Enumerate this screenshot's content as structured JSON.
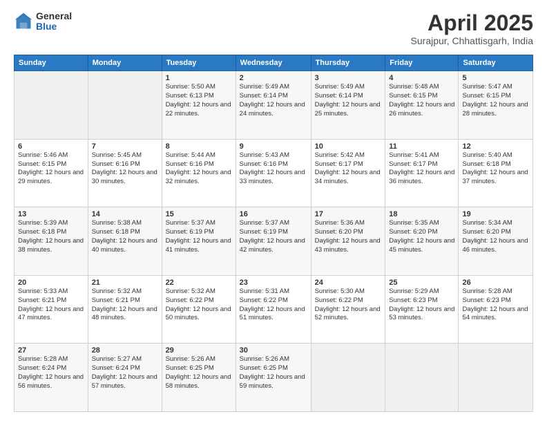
{
  "header": {
    "logo_general": "General",
    "logo_blue": "Blue",
    "title": "April 2025",
    "location": "Surajpur, Chhattisgarh, India"
  },
  "weekdays": [
    "Sunday",
    "Monday",
    "Tuesday",
    "Wednesday",
    "Thursday",
    "Friday",
    "Saturday"
  ],
  "weeks": [
    [
      {
        "day": "",
        "info": ""
      },
      {
        "day": "",
        "info": ""
      },
      {
        "day": "1",
        "info": "Sunrise: 5:50 AM\nSunset: 6:13 PM\nDaylight: 12 hours and 22 minutes."
      },
      {
        "day": "2",
        "info": "Sunrise: 5:49 AM\nSunset: 6:14 PM\nDaylight: 12 hours and 24 minutes."
      },
      {
        "day": "3",
        "info": "Sunrise: 5:49 AM\nSunset: 6:14 PM\nDaylight: 12 hours and 25 minutes."
      },
      {
        "day": "4",
        "info": "Sunrise: 5:48 AM\nSunset: 6:15 PM\nDaylight: 12 hours and 26 minutes."
      },
      {
        "day": "5",
        "info": "Sunrise: 5:47 AM\nSunset: 6:15 PM\nDaylight: 12 hours and 28 minutes."
      }
    ],
    [
      {
        "day": "6",
        "info": "Sunrise: 5:46 AM\nSunset: 6:15 PM\nDaylight: 12 hours and 29 minutes."
      },
      {
        "day": "7",
        "info": "Sunrise: 5:45 AM\nSunset: 6:16 PM\nDaylight: 12 hours and 30 minutes."
      },
      {
        "day": "8",
        "info": "Sunrise: 5:44 AM\nSunset: 6:16 PM\nDaylight: 12 hours and 32 minutes."
      },
      {
        "day": "9",
        "info": "Sunrise: 5:43 AM\nSunset: 6:16 PM\nDaylight: 12 hours and 33 minutes."
      },
      {
        "day": "10",
        "info": "Sunrise: 5:42 AM\nSunset: 6:17 PM\nDaylight: 12 hours and 34 minutes."
      },
      {
        "day": "11",
        "info": "Sunrise: 5:41 AM\nSunset: 6:17 PM\nDaylight: 12 hours and 36 minutes."
      },
      {
        "day": "12",
        "info": "Sunrise: 5:40 AM\nSunset: 6:18 PM\nDaylight: 12 hours and 37 minutes."
      }
    ],
    [
      {
        "day": "13",
        "info": "Sunrise: 5:39 AM\nSunset: 6:18 PM\nDaylight: 12 hours and 38 minutes."
      },
      {
        "day": "14",
        "info": "Sunrise: 5:38 AM\nSunset: 6:18 PM\nDaylight: 12 hours and 40 minutes."
      },
      {
        "day": "15",
        "info": "Sunrise: 5:37 AM\nSunset: 6:19 PM\nDaylight: 12 hours and 41 minutes."
      },
      {
        "day": "16",
        "info": "Sunrise: 5:37 AM\nSunset: 6:19 PM\nDaylight: 12 hours and 42 minutes."
      },
      {
        "day": "17",
        "info": "Sunrise: 5:36 AM\nSunset: 6:20 PM\nDaylight: 12 hours and 43 minutes."
      },
      {
        "day": "18",
        "info": "Sunrise: 5:35 AM\nSunset: 6:20 PM\nDaylight: 12 hours and 45 minutes."
      },
      {
        "day": "19",
        "info": "Sunrise: 5:34 AM\nSunset: 6:20 PM\nDaylight: 12 hours and 46 minutes."
      }
    ],
    [
      {
        "day": "20",
        "info": "Sunrise: 5:33 AM\nSunset: 6:21 PM\nDaylight: 12 hours and 47 minutes."
      },
      {
        "day": "21",
        "info": "Sunrise: 5:32 AM\nSunset: 6:21 PM\nDaylight: 12 hours and 48 minutes."
      },
      {
        "day": "22",
        "info": "Sunrise: 5:32 AM\nSunset: 6:22 PM\nDaylight: 12 hours and 50 minutes."
      },
      {
        "day": "23",
        "info": "Sunrise: 5:31 AM\nSunset: 6:22 PM\nDaylight: 12 hours and 51 minutes."
      },
      {
        "day": "24",
        "info": "Sunrise: 5:30 AM\nSunset: 6:22 PM\nDaylight: 12 hours and 52 minutes."
      },
      {
        "day": "25",
        "info": "Sunrise: 5:29 AM\nSunset: 6:23 PM\nDaylight: 12 hours and 53 minutes."
      },
      {
        "day": "26",
        "info": "Sunrise: 5:28 AM\nSunset: 6:23 PM\nDaylight: 12 hours and 54 minutes."
      }
    ],
    [
      {
        "day": "27",
        "info": "Sunrise: 5:28 AM\nSunset: 6:24 PM\nDaylight: 12 hours and 56 minutes."
      },
      {
        "day": "28",
        "info": "Sunrise: 5:27 AM\nSunset: 6:24 PM\nDaylight: 12 hours and 57 minutes."
      },
      {
        "day": "29",
        "info": "Sunrise: 5:26 AM\nSunset: 6:25 PM\nDaylight: 12 hours and 58 minutes."
      },
      {
        "day": "30",
        "info": "Sunrise: 5:26 AM\nSunset: 6:25 PM\nDaylight: 12 hours and 59 minutes."
      },
      {
        "day": "",
        "info": ""
      },
      {
        "day": "",
        "info": ""
      },
      {
        "day": "",
        "info": ""
      }
    ]
  ]
}
